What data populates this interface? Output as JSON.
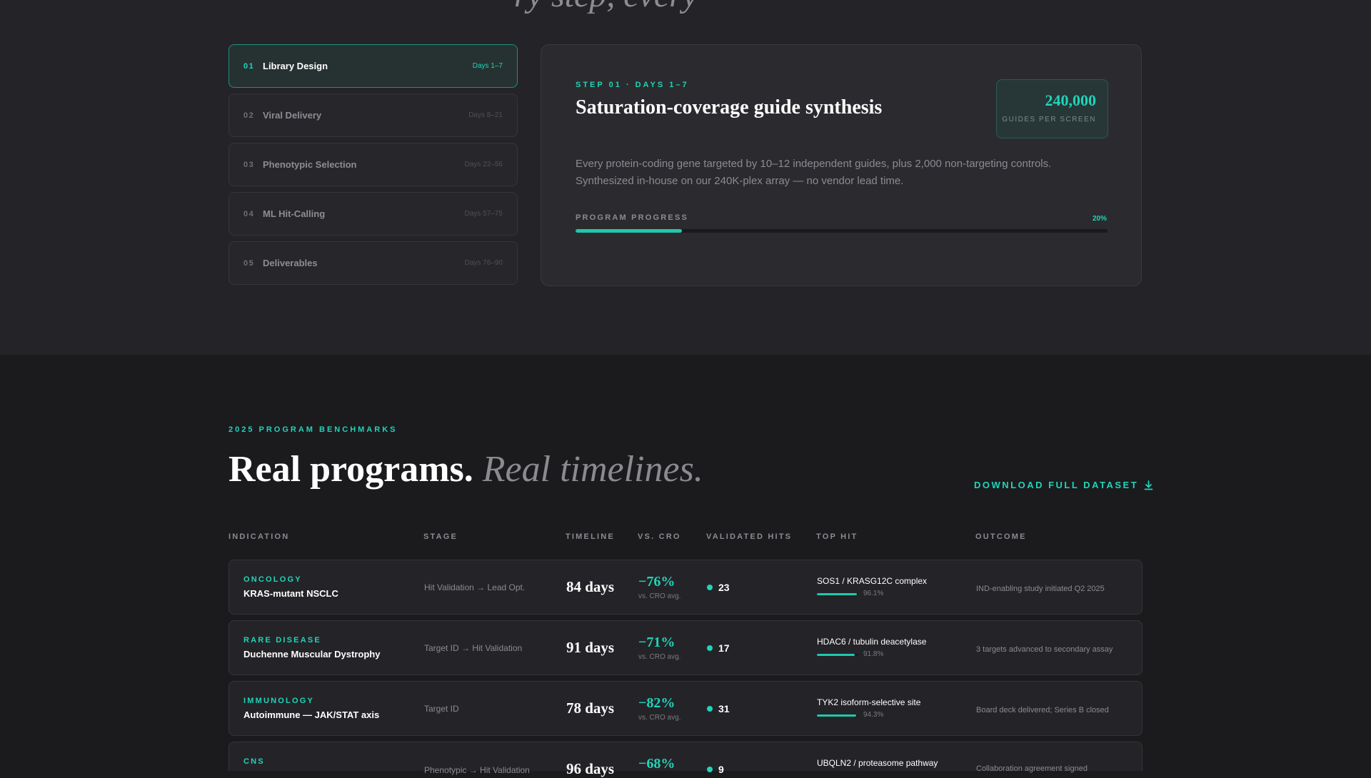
{
  "top_heading_partial": "ry step, every",
  "steps": [
    {
      "num": "01",
      "name": "Library Design",
      "days": "Days 1–7"
    },
    {
      "num": "02",
      "name": "Viral Delivery",
      "days": "Days 8–21"
    },
    {
      "num": "03",
      "name": "Phenotypic Selection",
      "days": "Days 22–56"
    },
    {
      "num": "04",
      "name": "ML Hit-Calling",
      "days": "Days 57–75"
    },
    {
      "num": "05",
      "name": "Deliverables",
      "days": "Days 76–90"
    }
  ],
  "active_step": 0,
  "detail": {
    "eyebrow": "STEP 01 · DAYS 1–7",
    "title": "Saturation-coverage guide synthesis",
    "stat_value": "240,000",
    "stat_label": "GUIDES PER SCREEN",
    "description": "Every protein-coding gene targeted by 10–12 independent guides, plus 2,000 non-targeting controls. Synthesized in-house on our 240K-plex array — no vendor lead time.",
    "progress_label": "PROGRAM PROGRESS",
    "progress_text": "20%",
    "progress_value": 0.2
  },
  "benchmarks": {
    "eyebrow": "2025 PROGRAM BENCHMARKS",
    "title_bold": "Real programs.",
    "title_italic": "Real timelines.",
    "download_label": "DOWNLOAD FULL DATASET",
    "columns": [
      "INDICATION",
      "STAGE",
      "TIMELINE",
      "VS. CRO",
      "VALIDATED HITS",
      "TOP HIT",
      "OUTCOME"
    ],
    "rows": [
      {
        "area": "ONCOLOGY",
        "indication": "KRAS-mutant NSCLC",
        "stage": "Hit Validation → Lead Opt.",
        "timeline": "84 days",
        "vs_cro": "−76%",
        "vs_cro_sub": "vs. CRO avg.",
        "hits": "23",
        "top_hit": "SOS1 / KRASG12C complex",
        "confidence_text": "96.1%",
        "confidence": 0.961,
        "outcome": "IND-enabling study initiated Q2 2025"
      },
      {
        "area": "RARE DISEASE",
        "indication": "Duchenne Muscular Dystrophy",
        "stage": "Target ID → Hit Validation",
        "timeline": "91 days",
        "vs_cro": "−71%",
        "vs_cro_sub": "vs. CRO avg.",
        "hits": "17",
        "top_hit": "HDAC6 / tubulin deacetylase",
        "confidence_text": "91.8%",
        "confidence": 0.918,
        "outcome": "3 targets advanced to secondary assay"
      },
      {
        "area": "IMMUNOLOGY",
        "indication": "Autoimmune — JAK/STAT axis",
        "stage": "Target ID",
        "timeline": "78 days",
        "vs_cro": "−82%",
        "vs_cro_sub": "vs. CRO avg.",
        "hits": "31",
        "top_hit": "TYK2 isoform-selective site",
        "confidence_text": "94.3%",
        "confidence": 0.943,
        "outcome": "Board deck delivered; Series B closed"
      },
      {
        "area": "CNS",
        "indication": "",
        "stage": "Phenotypic → Hit Validation",
        "timeline": "96 days",
        "vs_cro": "−68%",
        "vs_cro_sub": "",
        "hits": "9",
        "top_hit": "UBQLN2 / proteasome pathway",
        "confidence_text": "",
        "confidence": null,
        "outcome": "Collaboration agreement signed"
      }
    ]
  },
  "colors": {
    "accent": "#20d4b8",
    "top_bg": "#242428",
    "bottom_bg": "#1b1b1e"
  }
}
